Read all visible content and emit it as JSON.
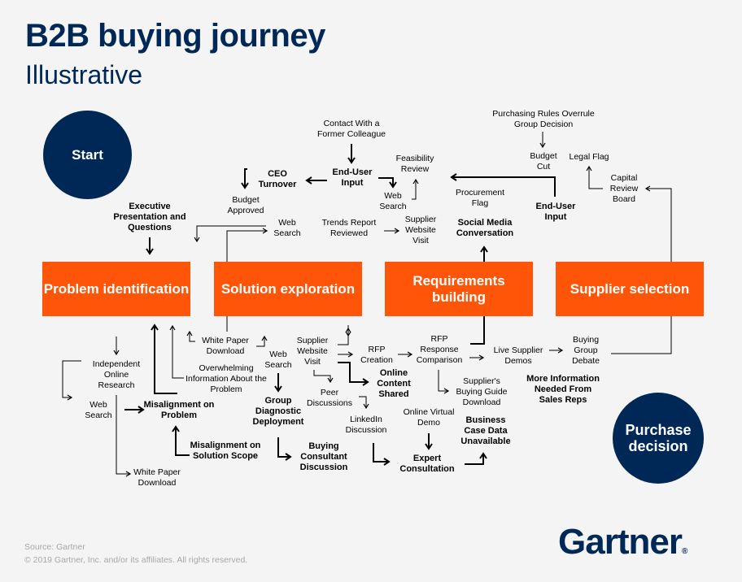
{
  "header": {
    "title": "B2B buying journey",
    "subtitle": "Illustrative"
  },
  "endpoints": {
    "start": "Start",
    "end": "Purchase decision"
  },
  "stages": [
    {
      "label": "Problem identification"
    },
    {
      "label": "Solution exploration"
    },
    {
      "label": "Requirements building"
    },
    {
      "label": "Supplier selection"
    }
  ],
  "nodes": {
    "contact_former_colleague": "Contact With a Former Colleague",
    "end_user_input_1": "End-User Input",
    "ceo_turnover": "CEO Turnover",
    "budget_approved": "Budget Approved",
    "feasibility_review": "Feasibility Review",
    "web_search_top": "Web Search",
    "executive_presentation": "Executive Presentation and Questions",
    "web_search_mid": "Web Search",
    "trends_report": "Trends Report Reviewed",
    "supplier_website_visit_top": "Supplier Website Visit",
    "procurement_flag": "Procurement Flag",
    "social_media": "Social Media Conversation",
    "purchasing_rules": "Purchasing Rules Overrule Group Decision",
    "budget_cut": "Budget Cut",
    "legal_flag": "Legal Flag",
    "capital_review_board": "Capital Review Board",
    "end_user_input_2": "End-User Input",
    "independent_research": "Independent Online Research",
    "web_search_left": "Web Search",
    "white_paper_bottom": "White Paper Download",
    "misalignment_problem": "Misalignment on Problem",
    "misalignment_scope": "Misalignment on Solution Scope",
    "white_paper_top": "White Paper Download",
    "overwhelming_info": "Overwhelming Information About the Problem",
    "web_search_center": "Web Search",
    "group_diagnostic": "Group Diagnostic Deployment",
    "buying_consultant": "Buying Consultant Discussion",
    "supplier_website_visit_mid": "Supplier Website Visit",
    "peer_discussions": "Peer Discussions",
    "linkedin_discussion": "LinkedIn Discussion",
    "online_content_shared": "Online Content Shared",
    "rfp_creation": "RFP Creation",
    "rfp_response_comparison": "RFP Response Comparison",
    "suppliers_buying_guide": "Supplier's Buying Guide Download",
    "online_virtual_demo": "Online Virtual Demo",
    "expert_consultation": "Expert Consultation",
    "business_case_unavailable": "Business Case Data Unavailable",
    "live_supplier_demos": "Live Supplier Demos",
    "buying_group_debate": "Buying Group Debate",
    "more_information_needed": "More Information Needed From Sales Reps"
  },
  "footer": {
    "source": "Source: Gartner",
    "copyright": "© 2019 Gartner, Inc. and/or its affiliates. All rights reserved.",
    "logo": "Gartner",
    "logo_mark": "®"
  },
  "colors": {
    "navy": "#002856",
    "orange": "#fe5509",
    "background": "#f4f4f4"
  }
}
